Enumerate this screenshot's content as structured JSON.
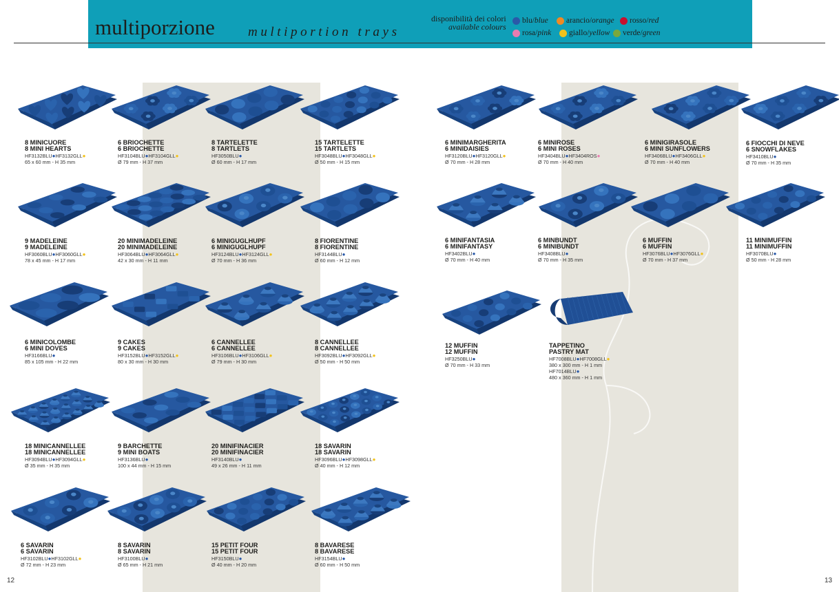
{
  "header": {
    "title": "multiporzione",
    "subtitle": "multiportion trays",
    "availability_it": "disponibilità dei colori",
    "availability_en": "available colours",
    "colors": [
      {
        "it": "blu",
        "en": "blue",
        "hex": "#2a59a8"
      },
      {
        "it": "arancio",
        "en": "orange",
        "hex": "#f08a24"
      },
      {
        "it": "rosso",
        "en": "red",
        "hex": "#c8102e"
      },
      {
        "it": "rosa",
        "en": "pink",
        "hex": "#e97cb0"
      },
      {
        "it": "giallo",
        "en": "yellow",
        "hex": "#f2c21b"
      },
      {
        "it": "verde",
        "en": "green",
        "hex": "#7aa83c"
      }
    ]
  },
  "products": [
    {
      "it": "8 MINICUORE",
      "en": "8 MINI HEARTS",
      "codes": [
        {
          "code": "HF3132BLU",
          "color": "blue"
        },
        {
          "code": "HF3132GLL",
          "color": "yellow"
        }
      ],
      "dims": "65 x 60 mm - H 35 mm",
      "icon": "heart-tray-icon"
    },
    {
      "it": "6 BRIOCHETTE",
      "en": "6 BRIOCHETTE",
      "codes": [
        {
          "code": "HF3104BLU",
          "color": "blue"
        },
        {
          "code": "HF3104GLL",
          "color": "yellow"
        }
      ],
      "dims": "Ø 79 mm - H 37 mm",
      "icon": "brioche-tray-icon"
    },
    {
      "it": "8 TARTELETTE",
      "en": "8 TARTLETS",
      "codes": [
        {
          "code": "HF3050BLU",
          "color": "blue"
        }
      ],
      "dims": "Ø 60 mm - H 17 mm",
      "icon": "tartlet-tray-icon"
    },
    {
      "it": "15 TARTELETTE",
      "en": "15 TARTLETS",
      "codes": [
        {
          "code": "HF3048BLU",
          "color": "blue"
        },
        {
          "code": "HF3048GLL",
          "color": "yellow"
        }
      ],
      "dims": "Ø 50 mm - H 15 mm",
      "icon": "tartlet-tray-icon"
    },
    {
      "it": "9 MADELEINE",
      "en": "9 MADELEINE",
      "codes": [
        {
          "code": "HF3060BLU",
          "color": "blue"
        },
        {
          "code": "HF3060GLL",
          "color": "yellow"
        }
      ],
      "dims": "78 x 45 mm - H 17 mm",
      "icon": "madeleine-tray-icon"
    },
    {
      "it": "20 MINIMADELEINE",
      "en": "20 MINIMADELEINE",
      "codes": [
        {
          "code": "HF3064BLU",
          "color": "blue"
        },
        {
          "code": "HF3064GLL",
          "color": "yellow"
        }
      ],
      "dims": "42 x 30 mm - H 11 mm",
      "icon": "madeleine-tray-icon"
    },
    {
      "it": "6 MINIGUGLHUPF",
      "en": "6 MINIGUGLHUPF",
      "codes": [
        {
          "code": "HF3124BLU",
          "color": "blue"
        },
        {
          "code": "HF3124GLL",
          "color": "yellow"
        }
      ],
      "dims": "Ø 70 mm - H 36 mm",
      "icon": "gugelhupf-tray-icon"
    },
    {
      "it": "8 FIORENTINE",
      "en": "8 FIORENTINE",
      "codes": [
        {
          "code": "HF3144BLU",
          "color": "blue"
        }
      ],
      "dims": "Ø 60 mm - H 12 mm",
      "icon": "florentine-tray-icon"
    },
    {
      "it": "6 MINICOLOMBE",
      "en": "6 MINI DOVES",
      "codes": [
        {
          "code": "HF3166BLU",
          "color": "blue"
        }
      ],
      "dims": "85 x 105 mm - H 22 mm",
      "icon": "dove-tray-icon"
    },
    {
      "it": "9 CAKES",
      "en": "9 CAKES",
      "codes": [
        {
          "code": "HF3152BLU",
          "color": "blue"
        },
        {
          "code": "HF3152GLL",
          "color": "yellow"
        }
      ],
      "dims": "80 x 30 mm - H 30 mm",
      "icon": "cake-tray-icon"
    },
    {
      "it": "6 CANNELLEE",
      "en": "6 CANNELLEE",
      "codes": [
        {
          "code": "HF3106BLU",
          "color": "blue"
        },
        {
          "code": "HF3106GLL",
          "color": "yellow"
        }
      ],
      "dims": "Ø 79 mm - H 30 mm",
      "icon": "cannelle-tray-icon"
    },
    {
      "it": "8 CANNELLEE",
      "en": "8 CANNELLEE",
      "codes": [
        {
          "code": "HF3092BLU",
          "color": "blue"
        },
        {
          "code": "HF3092GLL",
          "color": "yellow"
        }
      ],
      "dims": "Ø 50 mm - H 50 mm",
      "icon": "cannelle-tray-icon"
    },
    {
      "it": "18 MINICANNELLEE",
      "en": "18 MINICANNELLEE",
      "codes": [
        {
          "code": "HF3094BLU",
          "color": "blue"
        },
        {
          "code": "HF3094GLL",
          "color": "yellow"
        }
      ],
      "dims": "Ø 35 mm - H 35 mm",
      "icon": "cannelle-tray-icon"
    },
    {
      "it": "9 BARCHETTE",
      "en": "9 MINI BOATS",
      "codes": [
        {
          "code": "HF3136BLU",
          "color": "blue"
        }
      ],
      "dims": "100 x 44 mm - H 15 mm",
      "icon": "boat-tray-icon"
    },
    {
      "it": "20 MINIFINACIER",
      "en": "20 MINIFINACIER",
      "codes": [
        {
          "code": "HF3140BLU",
          "color": "blue"
        }
      ],
      "dims": "49 x 26 mm - H 11 mm",
      "icon": "financier-tray-icon"
    },
    {
      "it": "18 SAVARIN",
      "en": "18 SAVARIN",
      "codes": [
        {
          "code": "HF3096BLU",
          "color": "blue"
        },
        {
          "code": "HF3098GLL",
          "color": "yellow"
        }
      ],
      "dims": "Ø 40 mm - H 12 mm",
      "icon": "savarin-tray-icon"
    },
    {
      "it": "6 SAVARIN",
      "en": "6 SAVARIN",
      "codes": [
        {
          "code": "HF3102BLU",
          "color": "blue"
        },
        {
          "code": "HF3102GLL",
          "color": "yellow"
        }
      ],
      "dims": "Ø 72 mm - H 23 mm",
      "icon": "savarin-tray-icon"
    },
    {
      "it": "8 SAVARIN",
      "en": "8 SAVARIN",
      "codes": [
        {
          "code": "HF3100BLU",
          "color": "blue"
        }
      ],
      "dims": "Ø 65 mm - H 21 mm",
      "icon": "savarin-tray-icon"
    },
    {
      "it": "15 PETIT FOUR",
      "en": "15 PETIT FOUR",
      "codes": [
        {
          "code": "HF3150BLU",
          "color": "blue"
        }
      ],
      "dims": "Ø 40 mm - H 20 mm",
      "icon": "petit-four-tray-icon"
    },
    {
      "it": "8 BAVARESE",
      "en": "8 BAVARESE",
      "codes": [
        {
          "code": "HF3154BLU",
          "color": "blue"
        }
      ],
      "dims": "Ø 60 mm - H 50 mm",
      "icon": "bavarese-tray-icon"
    },
    {
      "it": "6 MINIMARGHERITA",
      "en": "6 MINIDAISIES",
      "codes": [
        {
          "code": "HF3120BLU",
          "color": "blue"
        },
        {
          "code": "HF3120GLL",
          "color": "yellow"
        }
      ],
      "dims": "Ø 70 mm - H 28 mm",
      "icon": "daisy-tray-icon"
    },
    {
      "it": "6 MINIROSE",
      "en": "6 MINI ROSES",
      "codes": [
        {
          "code": "HF3404BLU",
          "color": "blue"
        },
        {
          "code": "HF3404ROS",
          "color": "pink"
        }
      ],
      "dims": "Ø 70 mm - H 40 mm",
      "icon": "rose-tray-icon"
    },
    {
      "it": "6 MINIGIRASOLE",
      "en": "6 MINI SUNFLOWERS",
      "codes": [
        {
          "code": "HF3406BLU",
          "color": "blue"
        },
        {
          "code": "HF3406GLL",
          "color": "yellow"
        }
      ],
      "dims": "Ø 70 mm - H 40 mm",
      "icon": "sunflower-tray-icon"
    },
    {
      "it": "6 FIOCCHI DI NEVE",
      "en": "6 SNOWFLAKES",
      "codes": [
        {
          "code": "HF3410BLU",
          "color": "blue"
        }
      ],
      "dims": "Ø 70 mm - H 35 mm",
      "icon": "snowflake-tray-icon"
    },
    {
      "it": "6 MINIFANTASIA",
      "en": "6 MINIFANTASY",
      "codes": [
        {
          "code": "HF3402BLU",
          "color": "blue"
        }
      ],
      "dims": "Ø 70 mm - H 40 mm",
      "icon": "fantasy-tray-icon"
    },
    {
      "it": "6 MINBUNDT",
      "en": "6 MINIBUNDT",
      "codes": [
        {
          "code": "HF3408BLU",
          "color": "blue"
        }
      ],
      "dims": "Ø 70 mm - H 35 mm",
      "icon": "bundt-tray-icon"
    },
    {
      "it": "6 MUFFIN",
      "en": "6 MUFFIN",
      "codes": [
        {
          "code": "HF3076BLU",
          "color": "blue"
        },
        {
          "code": "HF3076GLL",
          "color": "yellow"
        }
      ],
      "dims": "Ø 70 mm - H 37 mm",
      "icon": "muffin-tray-icon"
    },
    {
      "it": "11 MINIMUFFIN",
      "en": "11 MINIMUFFIN",
      "codes": [
        {
          "code": "HF3070BLU",
          "color": "blue"
        }
      ],
      "dims": "Ø 50 mm - H 28 mm",
      "icon": "muffin-tray-icon"
    },
    {
      "it": "12 MUFFIN",
      "en": "12 MUFFIN",
      "codes": [
        {
          "code": "HF3250BLU",
          "color": "blue"
        }
      ],
      "dims": "Ø 70 mm - H 33 mm",
      "icon": "muffin-tray-icon"
    },
    {
      "it": "TAPPETINO",
      "en": "PASTRY MAT",
      "codes": [
        {
          "code": "HF7008BLU",
          "color": "blue"
        },
        {
          "code": "HF7008GLL",
          "color": "yellow"
        }
      ],
      "dims": "380 x 300 mm - H 1 mm",
      "codes2": [
        {
          "code": "HF7014BLU",
          "color": "blue"
        }
      ],
      "dims2": "480 x 360 mm - H 1 mm",
      "icon": "pastry-mat-icon"
    }
  ],
  "footer": {
    "page_left": "12",
    "page_right": "13"
  }
}
